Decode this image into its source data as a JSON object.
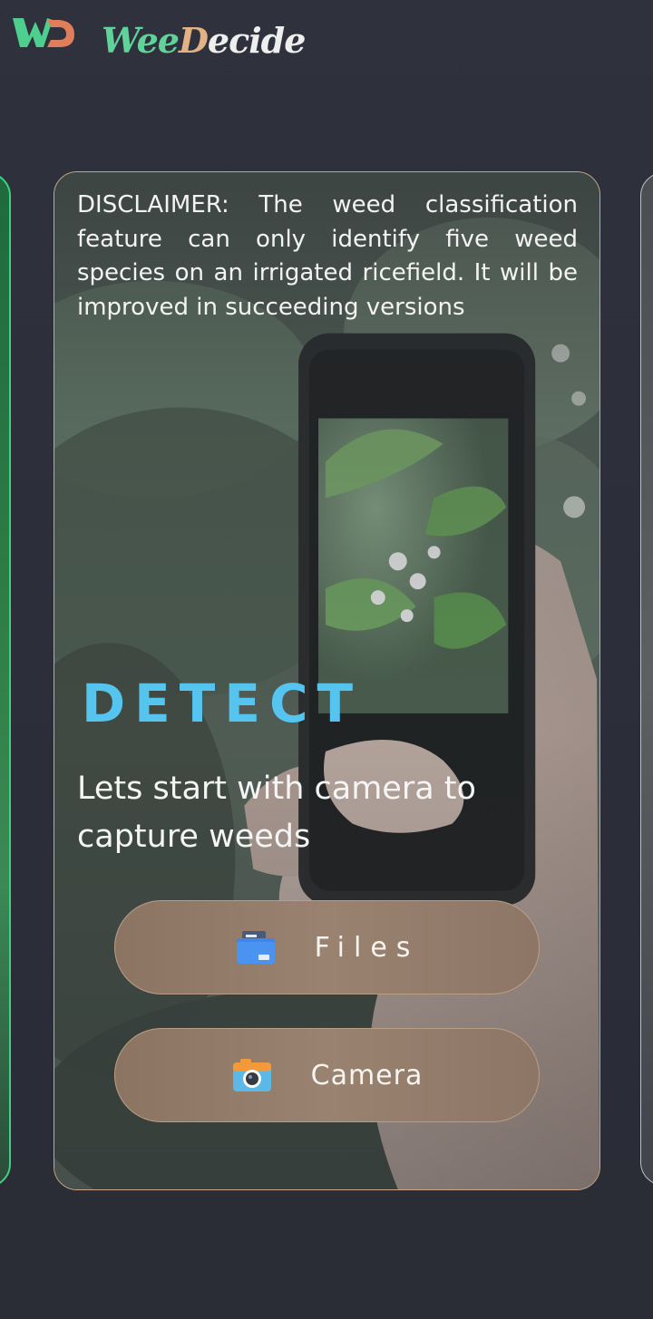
{
  "header": {
    "brand": {
      "part1": "Wee",
      "part2": "D",
      "part3": "ecide"
    },
    "logo_icon": "wd-logo-icon"
  },
  "card": {
    "disclaimer": "DISCLAIMER: The weed classification feature can only identify five weed species on an irrigated ricefield. It will be improved in succeeding versions",
    "title": "DETECT",
    "subtitle": "Lets start with camera to capture weeds",
    "buttons": [
      {
        "label": "Files",
        "icon": "folder-icon"
      },
      {
        "label": "Camera",
        "icon": "camera-icon"
      }
    ]
  },
  "colors": {
    "accent_green": "#5fd39a",
    "accent_blue": "#55c4ee",
    "accent_tan": "#e2b184",
    "background": "#2d2f3a"
  }
}
